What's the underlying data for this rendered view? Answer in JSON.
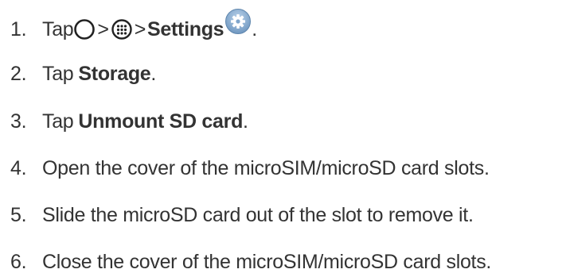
{
  "steps": [
    {
      "number": "1.",
      "parts": {
        "tap": "Tap",
        "gt1": ">",
        "gt2": ">",
        "settings": "Settings",
        "end": "."
      },
      "icons": [
        "home-icon",
        "apps-icon",
        "settings-gear-icon"
      ]
    },
    {
      "number": "2.",
      "prefix": "Tap",
      "bold": "Storage",
      "end": "."
    },
    {
      "number": "3.",
      "prefix": "Tap",
      "bold": "Unmount SD card",
      "end": "."
    },
    {
      "number": "4.",
      "text": "Open the cover of the microSIM/microSD card slots."
    },
    {
      "number": "5.",
      "text": "Slide the microSD card out of the slot to remove it."
    },
    {
      "number": "6.",
      "text": "Close the cover of the microSIM/microSD card slots."
    }
  ],
  "colors": {
    "text": "#333333",
    "icon_dark": "#222222",
    "settings_badge": "#8fb3d6"
  }
}
